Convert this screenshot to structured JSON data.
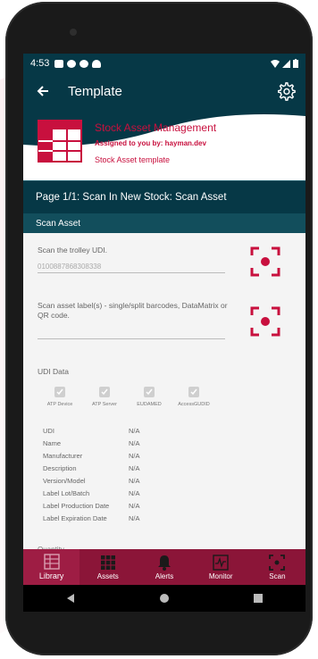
{
  "status_bar": {
    "time": "4:53"
  },
  "app_bar": {
    "title": "Template"
  },
  "header": {
    "title": "Stock Asset Management",
    "assigned": "Assigned to you by: hayman.dev",
    "template_name": "Stock Asset template"
  },
  "page": {
    "label": "Page 1/1: Scan In New Stock: Scan Asset"
  },
  "section": {
    "label": "Scan Asset"
  },
  "form": {
    "trolley_label": "Scan the trolley UDI.",
    "trolley_value": "0100887868308338",
    "asset_label": "Scan asset label(s) - single/split barcodes, DataMatrix or QR code.",
    "asset_value": ""
  },
  "udi": {
    "title": "UDI Data",
    "checks": [
      "ATP Device",
      "ATP Server",
      "EUDAMED",
      "AccessGUDID"
    ],
    "rows": [
      {
        "key": "UDI",
        "value": "N/A"
      },
      {
        "key": "Name",
        "value": "N/A"
      },
      {
        "key": "Manufacturer",
        "value": "N/A"
      },
      {
        "key": "Description",
        "value": "N/A"
      },
      {
        "key": "Version/Model",
        "value": "N/A"
      },
      {
        "key": "Label Lot/Batch",
        "value": "N/A"
      },
      {
        "key": "Label Production Date",
        "value": "N/A"
      },
      {
        "key": "Label Expiration Date",
        "value": "N/A"
      }
    ]
  },
  "quantity_label": "Quantity",
  "nav": {
    "items": [
      {
        "label": "Library",
        "icon": "library-icon"
      },
      {
        "label": "Assets",
        "icon": "assets-icon"
      },
      {
        "label": "Alerts",
        "icon": "bell-icon"
      },
      {
        "label": "Monitor",
        "icon": "monitor-icon"
      },
      {
        "label": "Scan",
        "icon": "scan-icon"
      }
    ]
  },
  "colors": {
    "primary": "#063846",
    "accent": "#c8103e",
    "nav": "#8b1538"
  }
}
